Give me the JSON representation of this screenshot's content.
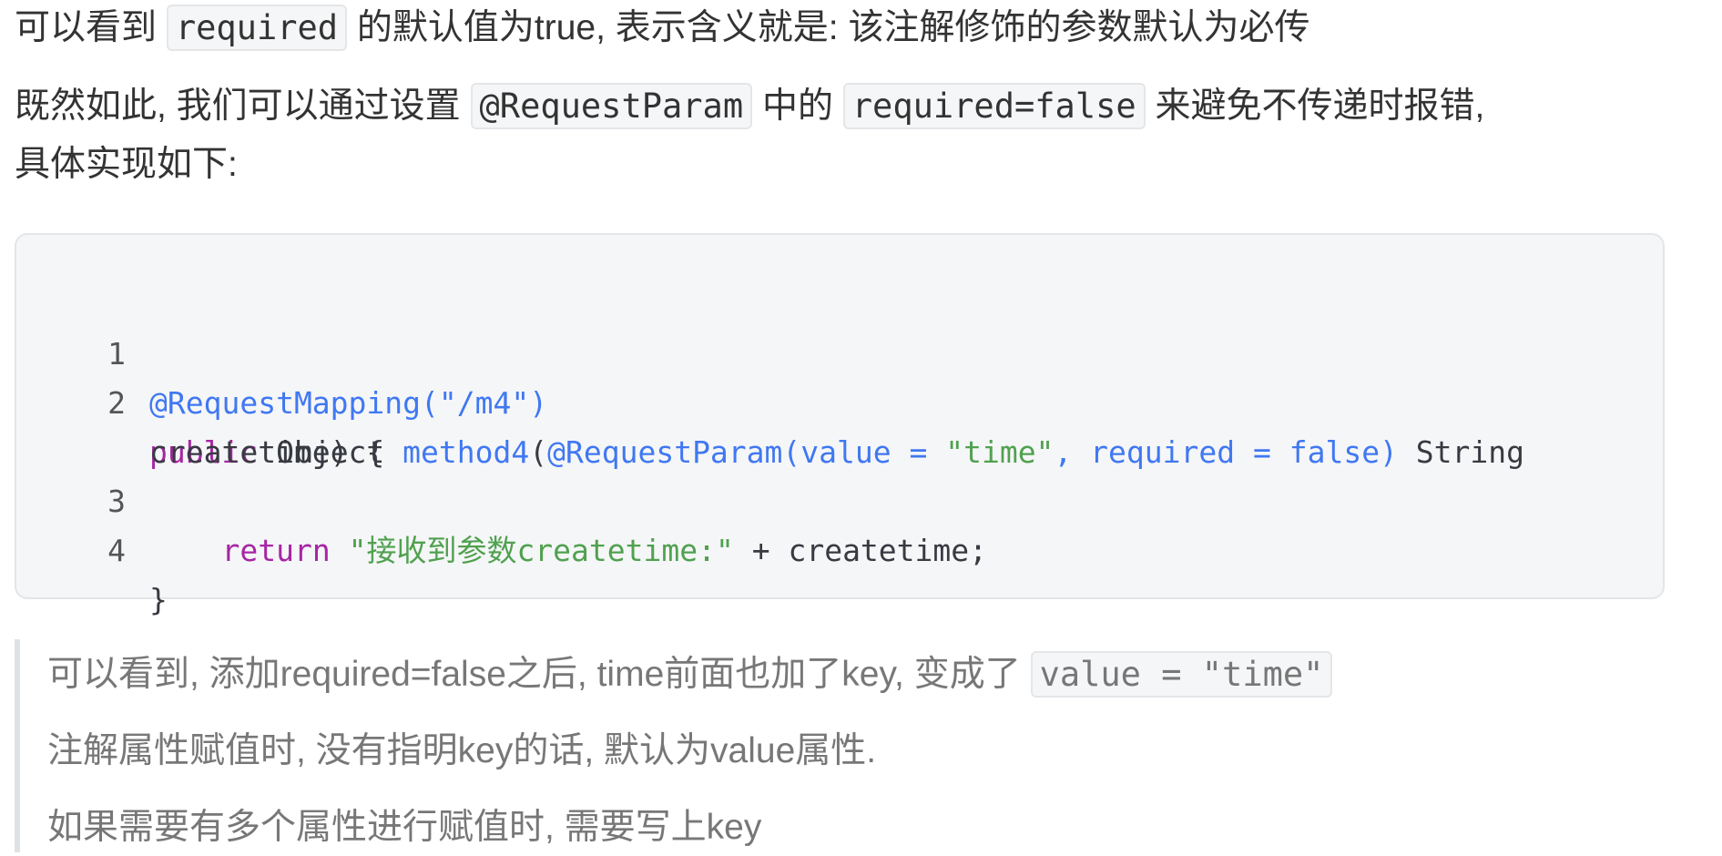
{
  "para1": {
    "text_before": "可以看到 ",
    "code": "required",
    "text_after": " 的默认值为true, 表示含义就是: 该注解修饰的参数默认为必传"
  },
  "para2": {
    "text_before": "既然如此, 我们可以通过设置 ",
    "code1": "@RequestParam",
    "text_middle": " 中的 ",
    "code2": "required=false",
    "text_after": " 来避免不传递时报错,"
  },
  "para3": {
    "text": "具体实现如下:"
  },
  "code_block": {
    "lines": [
      {
        "num": "1",
        "anno": "@RequestMapping(\"/m4\")"
      },
      {
        "num": "2",
        "kw": "public",
        "t1": " Object ",
        "method": "method4",
        "t2": "(",
        "anno": "@RequestParam(value = ",
        "str": "\"time\"",
        "anno2": ", required = false)",
        "t3": " String"
      },
      {
        "num": "",
        "cont": "createtime) {"
      },
      {
        "num": "3",
        "indent": "    ",
        "kw": "return",
        "str": " \"接收到参数createtime:\"",
        "t1": " + createtime;"
      },
      {
        "num": "4",
        "cont": "}"
      }
    ]
  },
  "quote": {
    "line1_before": "可以看到, 添加required=false之后,  time前面也加了key, 变成了 ",
    "line1_code": "value = \"time\"",
    "line2": "注解属性赋值时, 没有指明key的话, 默认为value属性.",
    "line3": "如果需要有多个属性进行赋值时, 需要写上key"
  },
  "colors": {
    "keyword": "#a626a4",
    "annotation": "#4078f2",
    "string": "#50a14f",
    "code_bg": "#f5f6f7"
  }
}
